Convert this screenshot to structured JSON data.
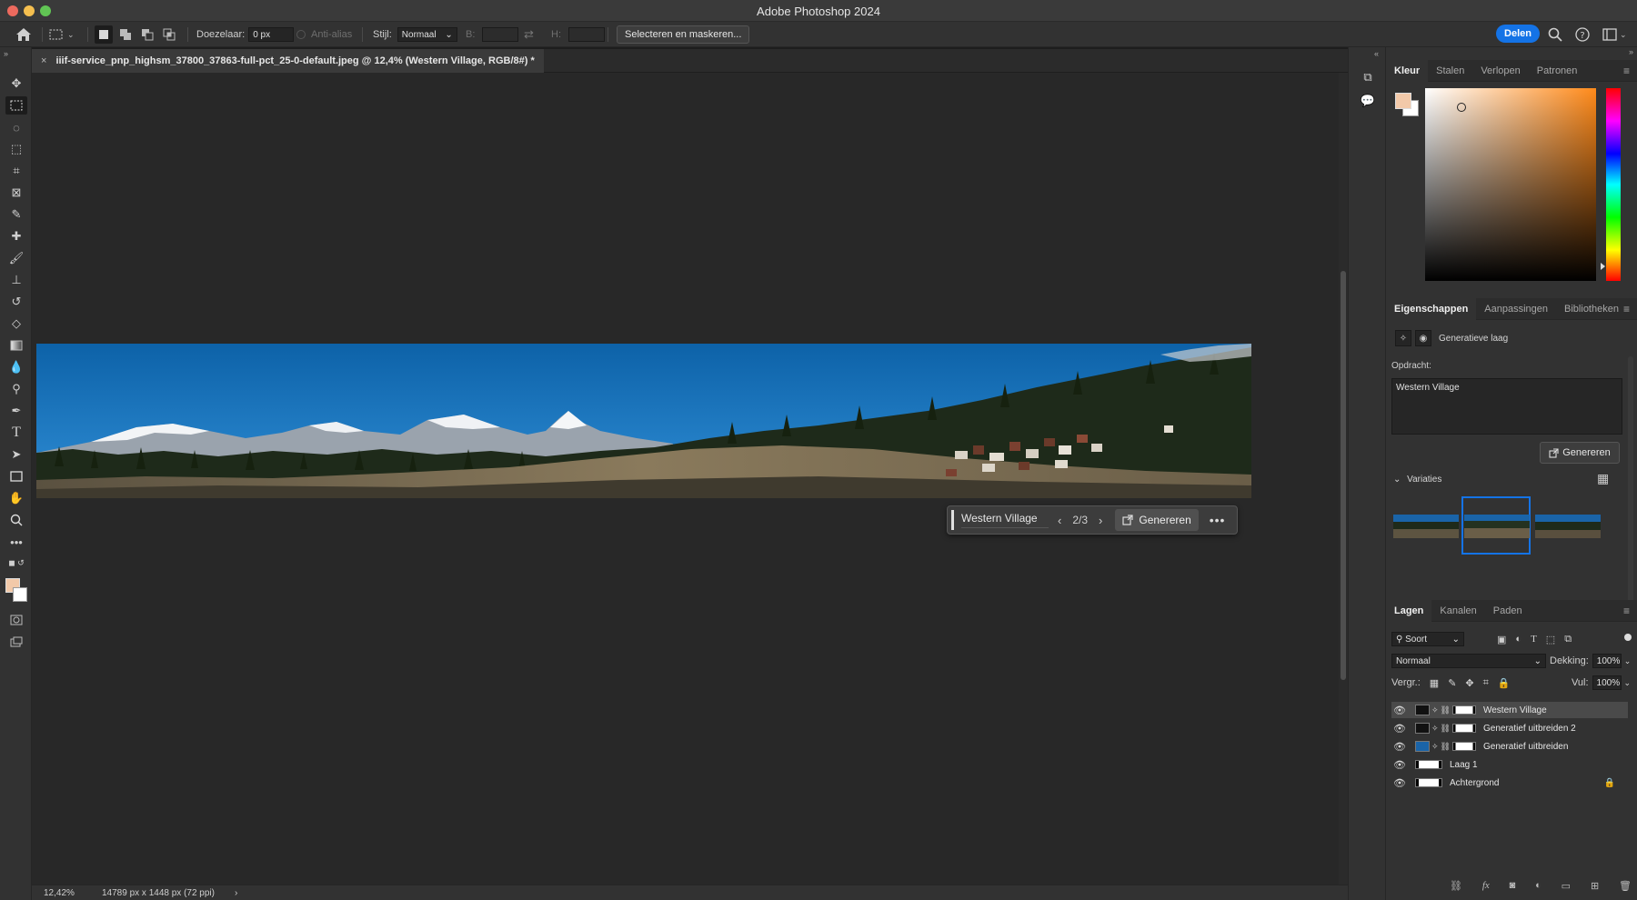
{
  "window": {
    "title": "Adobe Photoshop 2024"
  },
  "options_bar": {
    "feather_label": "Doezelaar:",
    "feather_value": "0 px",
    "antialias_label": "Anti-alias",
    "style_label": "Stijl:",
    "style_value": "Normaal",
    "width_label": "B:",
    "height_label": "H:",
    "select_mask_button": "Selecteren en maskeren...",
    "share_button": "Delen"
  },
  "document": {
    "tab_title": "iiif-service_pnp_highsm_37800_37863-full-pct_25-0-default.jpeg @ 12,4% (Western Village, RGB/8#) *"
  },
  "contextual_bar": {
    "prompt": "Western Village",
    "counter": "2/3",
    "generate_button": "Genereren",
    "more": "•••"
  },
  "status_bar": {
    "zoom": "12,42%",
    "dimensions": "14789 px x 1448 px (72 ppi)",
    "arrow": "›"
  },
  "color_panel": {
    "tabs": [
      "Kleur",
      "Stalen",
      "Verlopen",
      "Patronen"
    ],
    "foreground": "#f2c9a9",
    "background": "#ffffff"
  },
  "properties_panel": {
    "tabs": [
      "Eigenschappen",
      "Aanpassingen",
      "Bibliotheken"
    ],
    "layer_type": "Generatieve laag",
    "prompt_label": "Opdracht:",
    "prompt_value": "Western Village",
    "generate_button": "Genereren",
    "variations_label": "Variaties"
  },
  "layers_panel": {
    "tabs": [
      "Lagen",
      "Kanalen",
      "Paden"
    ],
    "filter_label": "Soort",
    "blend_mode": "Normaal",
    "opacity_label": "Dekking:",
    "opacity_value": "100%",
    "lock_label": "Vergr.:",
    "fill_label": "Vul:",
    "fill_value": "100%",
    "layers": [
      {
        "name": "Western Village",
        "selected": true
      },
      {
        "name": "Generatief uitbreiden 2",
        "selected": false
      },
      {
        "name": "Generatief uitbreiden",
        "selected": false
      },
      {
        "name": "Laag 1",
        "selected": false
      },
      {
        "name": "Achtergrond",
        "selected": false
      }
    ]
  },
  "colors": {
    "accent": "#1473e6"
  }
}
